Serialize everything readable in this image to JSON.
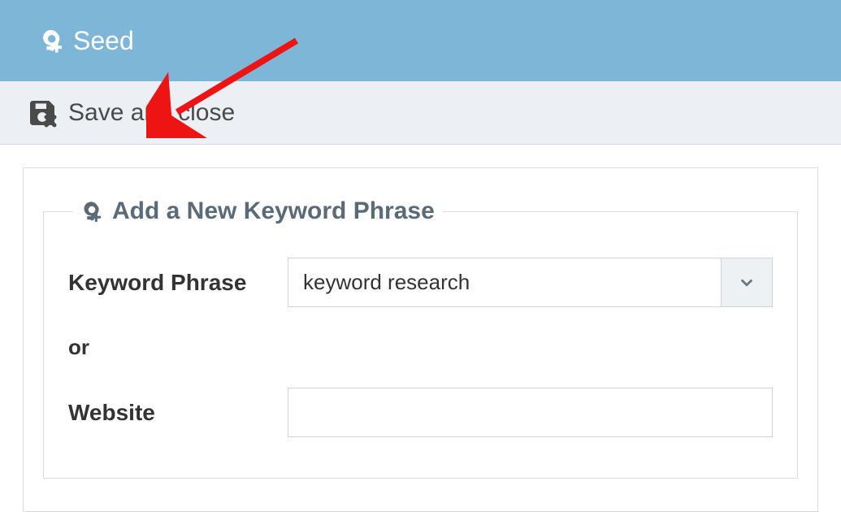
{
  "header": {
    "title": "Seed"
  },
  "toolbar": {
    "save_close_label": "Save and close"
  },
  "form": {
    "legend": "Add a New Keyword Phrase",
    "keyword_label": "Keyword Phrase",
    "keyword_value": "keyword research",
    "or_label": "or",
    "website_label": "Website",
    "website_value": ""
  },
  "colors": {
    "header_bg": "#7db6d6",
    "toolbar_bg": "#ecf0f5",
    "border": "#d8dde3",
    "text_dark": "#4a4a4a",
    "legend": "#5a6a77",
    "arrow": "#ef1414"
  }
}
